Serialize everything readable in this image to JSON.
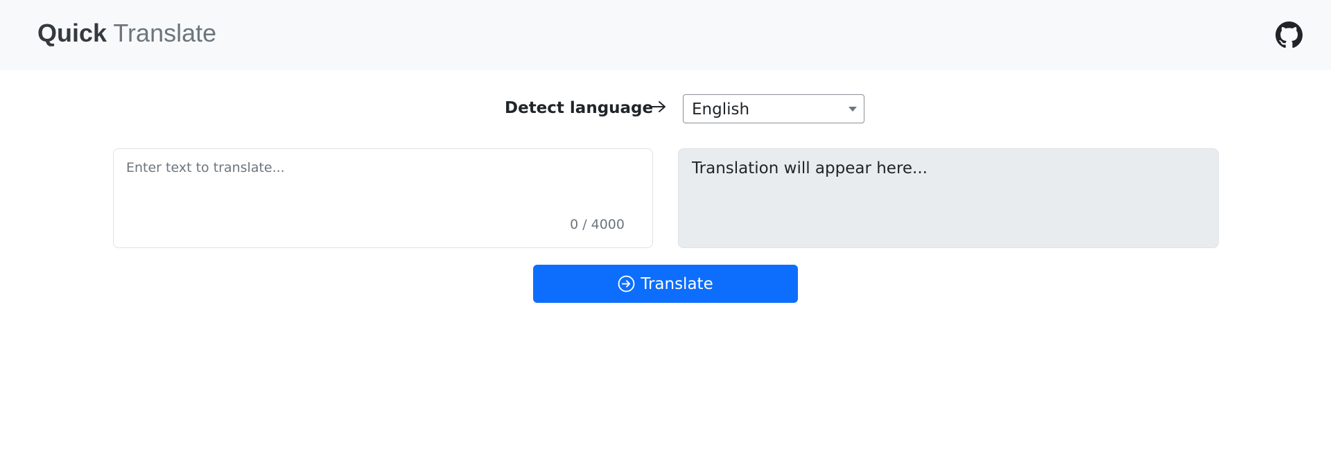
{
  "header": {
    "brand_bold": "Quick",
    "brand_light": "Translate",
    "github_icon": "github-icon",
    "background": "#f8f9fa"
  },
  "languages": {
    "source": "Detect language",
    "arrow_icon": "arrow-right-icon",
    "target_selected": "English"
  },
  "source": {
    "placeholder": "Enter text to translate...",
    "value": "",
    "char_count": "0 / 4000"
  },
  "target": {
    "placeholder": "Translation will appear here...",
    "background": "#e9ecef"
  },
  "translate_button": {
    "label": "Translate",
    "icon": "arrow-right-circle-icon",
    "color": "#0d6efd"
  }
}
